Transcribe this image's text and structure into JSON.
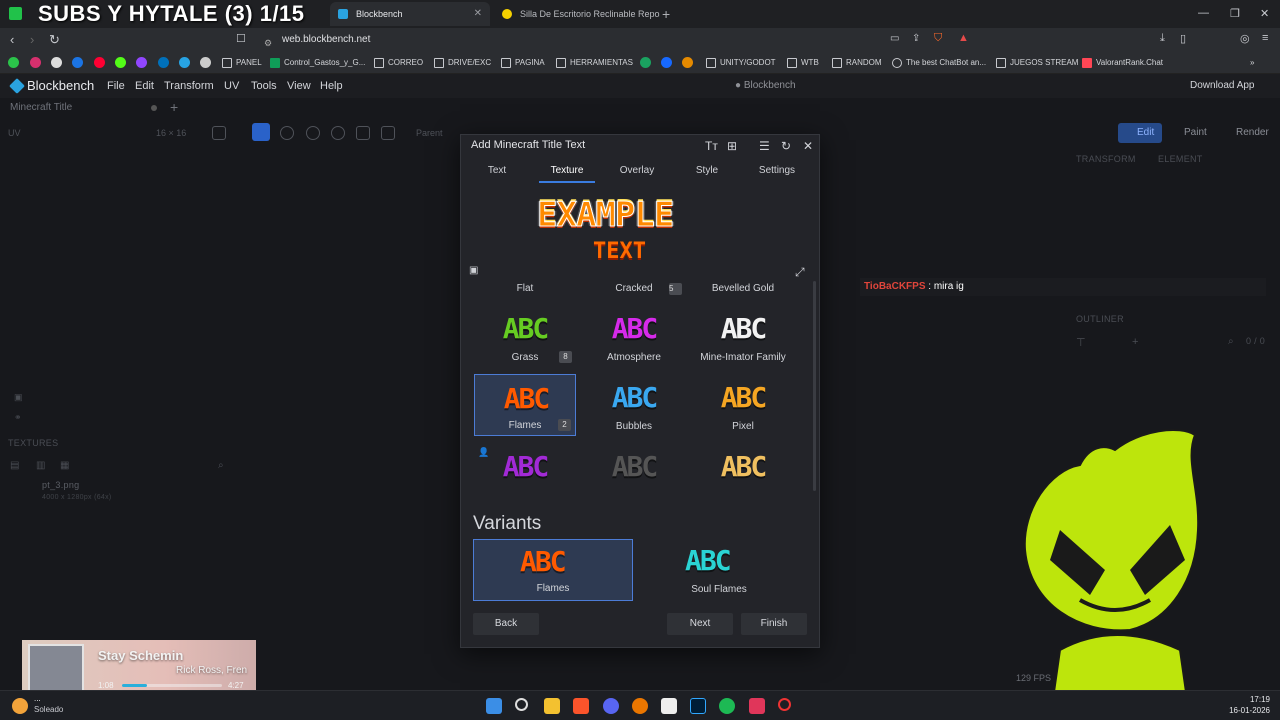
{
  "stream_overlay": {
    "title": "SUBS Y HYTALE (3) 1/15"
  },
  "browser": {
    "tabs": [
      {
        "title": "Blockbench",
        "active": true
      },
      {
        "title": "Silla De Escritorio Reclinable Reposap",
        "active": false
      }
    ],
    "address": "web.blockbench.net",
    "bookmarks": [
      "PANEL",
      "Control_Gastos_y_G...",
      "CORREO",
      "DRIVE/EXC",
      "PAGINA",
      "HERRAMIENTAS",
      "UNITY/GODOT",
      "WTB",
      "RANDOM",
      "The best ChatBot an...",
      "JUEGOS STREAM",
      "ValorantRank.Chat"
    ]
  },
  "blockbench": {
    "name": "Blockbench",
    "menus": [
      "File",
      "Edit",
      "Transform",
      "UV",
      "Tools",
      "View",
      "Help"
    ],
    "center_title": "● Blockbench",
    "download": "Download App",
    "project_tab": "Minecraft Title",
    "uv_label": "UV",
    "uv_size": "16 × 16",
    "parent_label": "Parent",
    "modes": {
      "edit": "Edit",
      "paint": "Paint",
      "render": "Render"
    },
    "panels": {
      "transform": "TRANSFORM",
      "element": "ELEMENT",
      "outliner": "OUTLINER",
      "outliner_count": "0 / 0",
      "textures": "TEXTURES"
    },
    "texture_item": {
      "name": "pt_3.png",
      "size": "4000 x 1280px (64x)"
    },
    "fps": "129 FPS"
  },
  "chat": {
    "user": "TioBaCKFPS",
    "message": ": mira ig"
  },
  "dialog": {
    "title": "Add Minecraft Title Text",
    "tabs": [
      "Text",
      "Texture",
      "Overlay",
      "Style",
      "Settings"
    ],
    "active_tab": "Texture",
    "preview_line1": "EXAMPLE",
    "preview_line2": "TEXT",
    "header_labels": [
      "Flat",
      "Cracked",
      "Bevelled Gold"
    ],
    "header_badge": "5",
    "textures": [
      {
        "name": "Grass",
        "glyph": "ABC",
        "color": "#66cc22",
        "badge": "8"
      },
      {
        "name": "Atmosphere",
        "glyph": "ABC",
        "color": "#d62aea",
        "badge": ""
      },
      {
        "name": "Mine-Imator Family",
        "glyph": "ABC",
        "color": "#f2f2f2",
        "badge": ""
      },
      {
        "name": "Flames",
        "glyph": "ABC",
        "color": "#ff5a00",
        "badge": "2"
      },
      {
        "name": "Bubbles",
        "glyph": "ABC",
        "color": "#3aa8f0",
        "badge": ""
      },
      {
        "name": "Pixel",
        "glyph": "ABC",
        "color": "#f5a623",
        "badge": ""
      },
      {
        "name": "",
        "glyph": "ABC",
        "color": "#a22ad6",
        "badge": ""
      },
      {
        "name": "",
        "glyph": "ABC",
        "color": "#555555",
        "badge": ""
      },
      {
        "name": "",
        "glyph": "ABC",
        "color": "#f0c060",
        "badge": ""
      }
    ],
    "selected_texture": "Flames",
    "variants_heading": "Variants",
    "variants": [
      {
        "name": "Flames",
        "glyph": "ABC",
        "color": "#ff5a00"
      },
      {
        "name": "Soul Flames",
        "glyph": "ABC",
        "color": "#2ad4d4"
      }
    ],
    "buttons": {
      "back": "Back",
      "next": "Next",
      "finish": "Finish"
    }
  },
  "media": {
    "title": "Stay Schemin",
    "artist": "Rick Ross, Fren",
    "current": "1:08",
    "total": "4:27",
    "progress": 0.25
  },
  "taskbar": {
    "weather": "Soleado",
    "weather_temp": "...",
    "time": "17:19",
    "date": "16-01-2026"
  }
}
